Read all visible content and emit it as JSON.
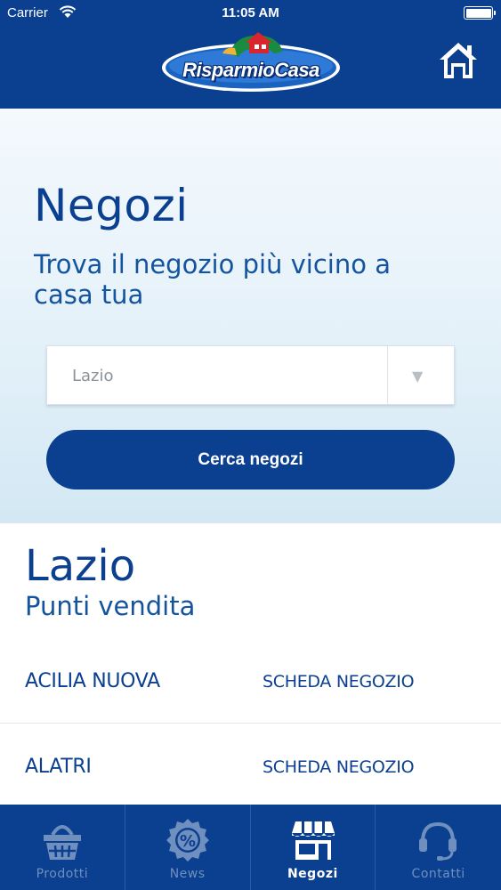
{
  "status_bar": {
    "carrier": "Carrier",
    "time": "11:05 AM"
  },
  "header": {
    "logo_text": "RisparmioCasa",
    "home_icon": "home-icon"
  },
  "hero": {
    "title": "Negozi",
    "subtitle": "Trova il negozio più vicino a casa tua",
    "region_select": {
      "value": "Lazio",
      "arrow": "▼"
    },
    "search_button": "Cerca negozi"
  },
  "results": {
    "region": "Lazio",
    "subtitle": "Punti vendita",
    "stores": [
      {
        "name": "ACILIA NUOVA",
        "link": "SCHEDA NEGOZIO"
      },
      {
        "name": "ALATRI",
        "link": "SCHEDA NEGOZIO"
      }
    ]
  },
  "tabbar": {
    "tabs": [
      {
        "label": "Prodotti",
        "icon": "basket-icon",
        "active": false
      },
      {
        "label": "News",
        "icon": "percent-badge-icon",
        "active": false
      },
      {
        "label": "Negozi",
        "icon": "store-icon",
        "active": true
      },
      {
        "label": "Contatti",
        "icon": "headset-icon",
        "active": false
      }
    ]
  },
  "colors": {
    "brand_blue": "#0b3f8f",
    "inactive_tab": "#6f8fbf",
    "placeholder_gray": "#8a939a"
  }
}
